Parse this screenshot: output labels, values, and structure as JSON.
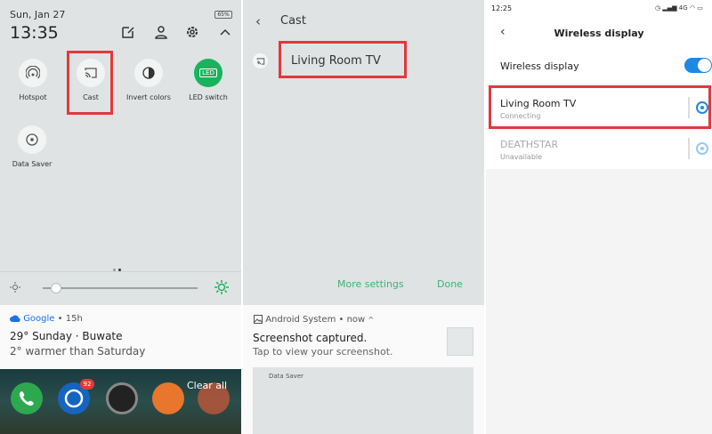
{
  "quick_settings": {
    "date": "Sun, Jan 27",
    "time": "13:35",
    "battery": "65%",
    "tiles": [
      {
        "label": "Hotspot",
        "icon": "hotspot-icon"
      },
      {
        "label": "Cast",
        "icon": "cast-icon"
      },
      {
        "label": "Invert colors",
        "icon": "invert-colors-icon"
      },
      {
        "label": "LED switch",
        "icon": "led-icon",
        "icon_text": "LED"
      },
      {
        "label": "Data Saver",
        "icon": "data-saver-icon"
      }
    ],
    "notification": {
      "app": "Google",
      "age": "• 15h",
      "title": "29° Sunday · Buwate",
      "subtitle": "2° warmer than Saturday"
    },
    "dock": {
      "clear_all": "Clear all",
      "badge_count": "92"
    },
    "colors": {
      "accent": "#19b35c",
      "highlight": "#e0393e"
    }
  },
  "cast_panel": {
    "back": "‹",
    "title": "Cast",
    "device": "Living Room TV",
    "more_settings": "More settings",
    "done": "Done",
    "notification": {
      "app": "Android System",
      "age": "• now",
      "title": "Screenshot captured.",
      "subtitle": "Tap to view your screenshot.",
      "preview_label": "Data Saver"
    }
  },
  "wireless_display": {
    "status_time": "12:25",
    "status_network": "4G",
    "title": "Wireless display",
    "toggle_label": "Wireless display",
    "toggle_on": true,
    "devices": [
      {
        "name": "Living Room TV",
        "status": "Connecting"
      },
      {
        "name": "DEATHSTAR",
        "status": "Unavailable"
      }
    ],
    "colors": {
      "toggle": "#1e88e5"
    }
  }
}
